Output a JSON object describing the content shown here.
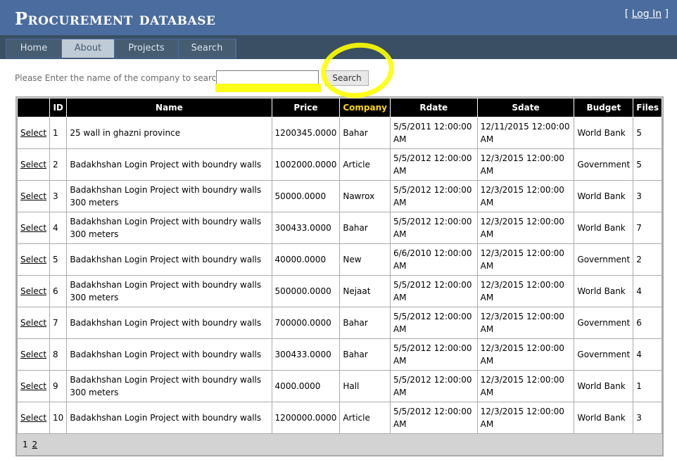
{
  "header": {
    "title": "Procurement database",
    "login_open": "[ ",
    "login_label": "Log In",
    "login_close": " ]"
  },
  "menu": [
    {
      "label": "Home",
      "width": 78
    },
    {
      "label": "About",
      "width": 74
    },
    {
      "label": "Projects",
      "width": 90
    },
    {
      "label": "Search",
      "width": 80
    }
  ],
  "search": {
    "label": "Please Enter the name of the company to search",
    "value": "",
    "button_label": "Search"
  },
  "annotation_color": "#ffff00",
  "table": {
    "headers": [
      "",
      "ID",
      "Name",
      "Price",
      "Company",
      "Rdate",
      "Sdate",
      "Budget",
      "Files"
    ],
    "select_label": "Select",
    "rows": [
      {
        "id": "1",
        "name": "25 wall in ghazni province",
        "price": "1200345.0000",
        "company": "Bahar",
        "rdate": "5/5/2011 12:00:00 AM",
        "sdate": "12/11/2015 12:00:00 AM",
        "budget": "World Bank",
        "files": "5"
      },
      {
        "id": "2",
        "name": "Badakhshan Login Project with boundry walls",
        "price": "1002000.0000",
        "company": "Article",
        "rdate": "5/5/2012 12:00:00 AM",
        "sdate": "12/3/2015 12:00:00 AM",
        "budget": "Government",
        "files": "5"
      },
      {
        "id": "3",
        "name": "Badakhshan Login Project with boundry walls 300 meters",
        "price": "50000.0000",
        "company": "Nawrox",
        "rdate": "5/5/2012 12:00:00 AM",
        "sdate": "12/3/2015 12:00:00 AM",
        "budget": "World Bank",
        "files": "3"
      },
      {
        "id": "4",
        "name": "Badakhshan Login Project with boundry walls 300 meters",
        "price": "300433.0000",
        "company": "Bahar",
        "rdate": "5/5/2012 12:00:00 AM",
        "sdate": "12/3/2015 12:00:00 AM",
        "budget": "World Bank",
        "files": "7"
      },
      {
        "id": "5",
        "name": "Badakhshan Login Project with boundry walls",
        "price": "40000.0000",
        "company": "New",
        "rdate": "6/6/2010 12:00:00 AM",
        "sdate": "12/3/2015 12:00:00 AM",
        "budget": "Government",
        "files": "2"
      },
      {
        "id": "6",
        "name": "Badakhshan Login Project with boundry walls 300 meters",
        "price": "500000.0000",
        "company": "Nejaat",
        "rdate": "5/5/2012 12:00:00 AM",
        "sdate": "12/3/2015 12:00:00 AM",
        "budget": "World Bank",
        "files": "4"
      },
      {
        "id": "7",
        "name": "Badakhshan Login Project with boundry walls",
        "price": "700000.0000",
        "company": "Bahar",
        "rdate": "5/5/2012 12:00:00 AM",
        "sdate": "12/3/2015 12:00:00 AM",
        "budget": "Government",
        "files": "6"
      },
      {
        "id": "8",
        "name": "Badakhshan Login Project with boundry walls",
        "price": "300433.0000",
        "company": "Bahar",
        "rdate": "5/5/2012 12:00:00 AM",
        "sdate": "12/3/2015 12:00:00 AM",
        "budget": "Government",
        "files": "4"
      },
      {
        "id": "9",
        "name": "Badakhshan Login Project with boundry walls 300 meters",
        "price": "4000.0000",
        "company": "Hall",
        "rdate": "5/5/2012 12:00:00 AM",
        "sdate": "12/3/2015 12:00:00 AM",
        "budget": "World Bank",
        "files": "1"
      },
      {
        "id": "10",
        "name": "Badakhshan Login Project with boundry walls",
        "price": "1200000.0000",
        "company": "Article",
        "rdate": "5/5/2012 12:00:00 AM",
        "sdate": "12/3/2015 12:00:00 AM",
        "budget": "World Bank",
        "files": "3"
      }
    ]
  },
  "pager": {
    "current": "1",
    "pages": [
      "2"
    ]
  }
}
